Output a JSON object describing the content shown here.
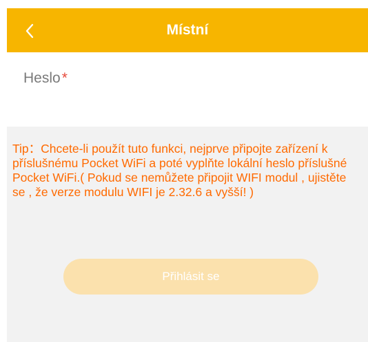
{
  "header": {
    "title": "Místní",
    "back_icon": "chevron-left-icon"
  },
  "password_field": {
    "label": "Heslo",
    "required_mark": "*",
    "value": "",
    "placeholder": ""
  },
  "tip": {
    "text": "Tip：Chcete-li použít tuto funkci, nejprve připojte zařízení k příslušnému Pocket WiFi a poté vyplňte lokální heslo příslušné Pocket WiFi.( Pokud se nemůžete připojit WIFI modul , ujistěte se , že verze modulu WIFI je 2.32.6 a vyšší! )"
  },
  "login_button": {
    "label": "Přihlásit se",
    "disabled": true
  },
  "colors": {
    "header_bg": "#f7b500",
    "tip_text": "#ff6a00",
    "button_bg_disabled": "#fbe1ad",
    "content_bg": "#f2f2f2",
    "required_mark": "#e64a3b"
  }
}
